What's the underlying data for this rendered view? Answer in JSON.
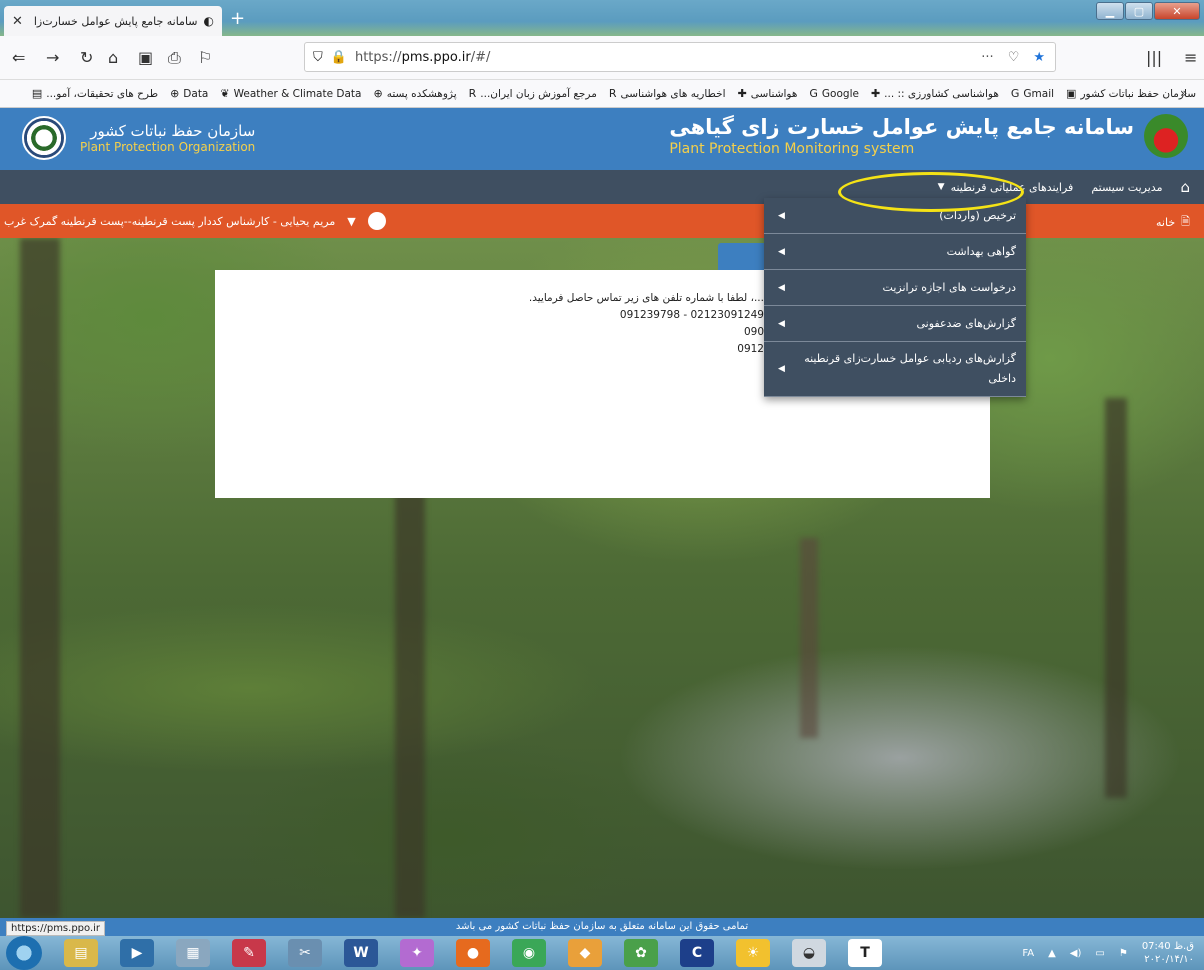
{
  "browser": {
    "tab_title": "سامانه جامع پایش عوامل خسارت‌زا",
    "tab_close": "✕",
    "tab_audio": "◐",
    "new_tab": "+",
    "url_https": "https://",
    "url_host": "pms.ppo.ir",
    "url_path": "/#/",
    "url_more": "···",
    "status_url": "https://pms.ppo.ir",
    "bookmarks": [
      {
        "icon": "gov-icon",
        "label": "سازمان حفظ نباتات کشور"
      },
      {
        "icon": "google-icon",
        "label": "Gmail"
      },
      {
        "icon": "cross-icon",
        "label": "هواشناسی کشاورزی :: ..."
      },
      {
        "icon": "google-icon",
        "label": "Google"
      },
      {
        "icon": "cross-icon",
        "label": "هواشناسی"
      },
      {
        "icon": "r-icon",
        "label": "اخطاریه های هواشناسی"
      },
      {
        "icon": "r-icon",
        "label": "مرجع آموزش زبان ایران..."
      },
      {
        "icon": "globe-icon",
        "label": "پژوهشکده پسته"
      },
      {
        "icon": "leaf-icon",
        "label": "Weather & Climate Data"
      },
      {
        "icon": "globe-icon",
        "label": "Data"
      },
      {
        "icon": "doc-icon",
        "label": "طرح های تحقیقات، آمو..."
      }
    ]
  },
  "site": {
    "title_fa": "سامانه جامع پایش عوامل خسارت زای گیاهی",
    "title_en": "Plant Protection Monitoring system",
    "org_fa": "سازمان حفظ نباتات کشور",
    "org_en": "Plant Protection Organization"
  },
  "menu": {
    "home_icon": "home-icon",
    "items": [
      {
        "label": "مدیریت سیستم"
      },
      {
        "label": "فرایندهای عملیاتی قرنطینه"
      }
    ]
  },
  "userbar": {
    "home_label": "خانه",
    "user_label": "مریم یحیایی - کارشناس کددار پست قرنطینه--پست قرنطینه گمرک غرب"
  },
  "card": {
    "line1": "...، لطفا با شماره تلفن های زیر تماس حاصل فرمایید.",
    "line2": "02123091249 - 091239798",
    "line3": "090",
    "line4": "0912"
  },
  "dropdown": [
    {
      "label": "ترخیص (واردات)"
    },
    {
      "label": "گواهی بهداشت"
    },
    {
      "label": "درخواست های اجازه ترانزیت"
    },
    {
      "label": "گزارش‌های ضدعفونی"
    },
    {
      "label": "گزارش‌های ردیابی عوامل خسارت‌زای قرنطینه داخلی"
    }
  ],
  "footer": {
    "text": "تمامی حقوق این سامانه متعلق به سازمان حفظ نباتات کشور می باشد"
  },
  "taskbar": {
    "lang": "FA",
    "time": "07:40 ق.ظ",
    "date": "۲۰۲۰/۱۴/۱۰"
  },
  "colors": {
    "header_blue": "#3d7fc0",
    "menu_dark": "#3f4f61",
    "user_orange": "#e05628",
    "highlight_yellow": "#f5e316"
  }
}
